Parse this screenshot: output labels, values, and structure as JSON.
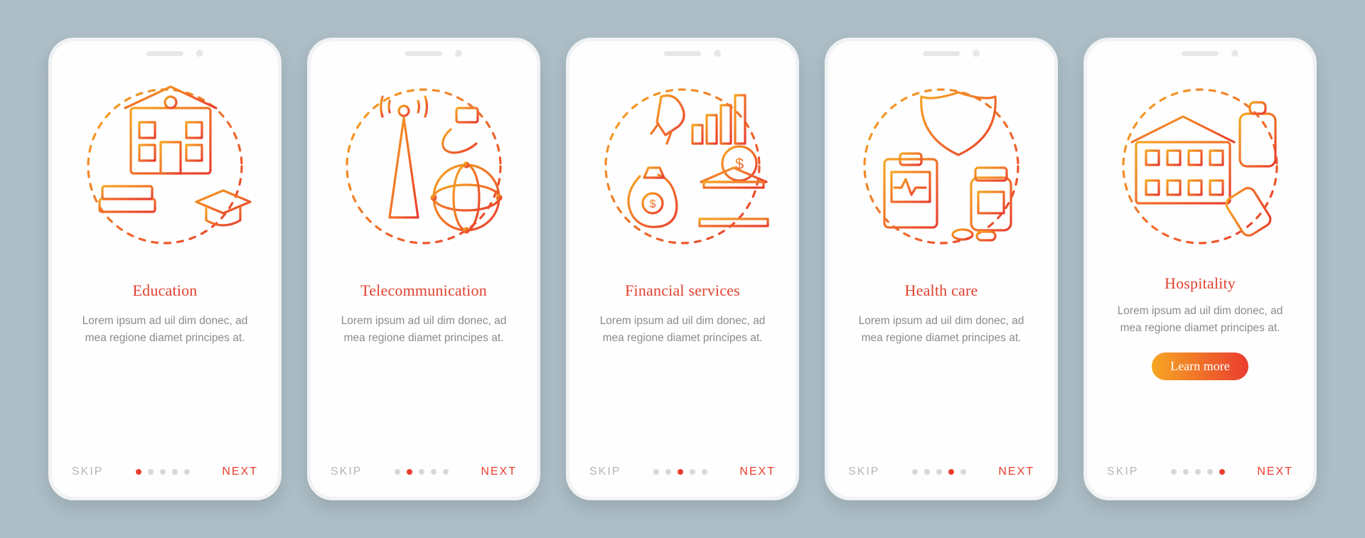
{
  "common": {
    "skip_label": "SKIP",
    "next_label": "NEXT",
    "lorem": "Lorem ipsum ad uil dim donec, ad mea regione diamet principes at.",
    "learn_more_label": "Learn more"
  },
  "screens": [
    {
      "title": "Education",
      "icon": "education-icon",
      "active_index": 0,
      "has_learn_more": false
    },
    {
      "title": "Telecommunication",
      "icon": "telecommunication-icon",
      "active_index": 1,
      "has_learn_more": false
    },
    {
      "title": "Financial services",
      "icon": "financial-icon",
      "active_index": 2,
      "has_learn_more": false
    },
    {
      "title": "Health care",
      "icon": "healthcare-icon",
      "active_index": 3,
      "has_learn_more": false
    },
    {
      "title": "Hospitality",
      "icon": "hospitality-icon",
      "active_index": 4,
      "has_learn_more": true
    }
  ],
  "colors": {
    "accent": "#ea3d2f",
    "accent_light": "#f6a623",
    "grey_text": "#888b8d",
    "pip_off": "#d7d8da",
    "bg": "#adbec7"
  }
}
